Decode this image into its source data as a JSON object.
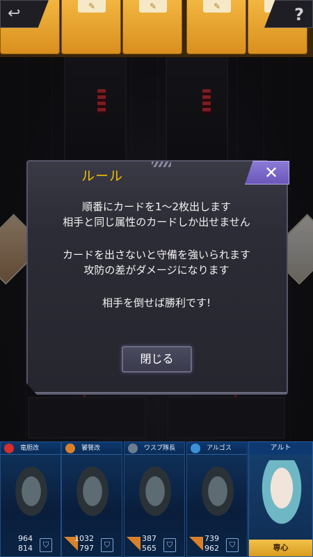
{
  "top_bar": {
    "back_icon": "back-arrow-icon",
    "back_glyph": "↩",
    "help_icon": "question-icon",
    "help_glyph": "?",
    "card_count": 5,
    "card_emblem_glyph": "✎"
  },
  "dialog": {
    "title": "ルール",
    "close_glyph": "✕",
    "lines": [
      "順番にカードを1〜2枚出します",
      "相手と同じ属性のカードしか出せません",
      "カードを出さないと守備を強いられます",
      "攻防の差がダメージになります",
      "相手を倒せば勝利です!"
    ],
    "confirm_label": "閉じる"
  },
  "units": [
    {
      "name": "竜胆改",
      "attack": "964",
      "defense": "814",
      "attr_color": "#d62d2d"
    },
    {
      "name": "饕餮改",
      "attack": "1032",
      "defense": "797",
      "attr_color": "#d9812a"
    },
    {
      "name": "ワスプ隊長",
      "attack": "387",
      "defense": "565",
      "attr_color": "#6d7d90"
    },
    {
      "name": "アルゴス",
      "attack": "739",
      "defense": "962",
      "attr_color": "#3d8fd6"
    }
  ],
  "leader": {
    "name": "アルト",
    "status": "専心"
  },
  "colors": {
    "title": "#f5c000",
    "card_orange": "#e9a22e",
    "close_purple": "#7a68c8",
    "panel_blue": "#0b1e3a"
  }
}
